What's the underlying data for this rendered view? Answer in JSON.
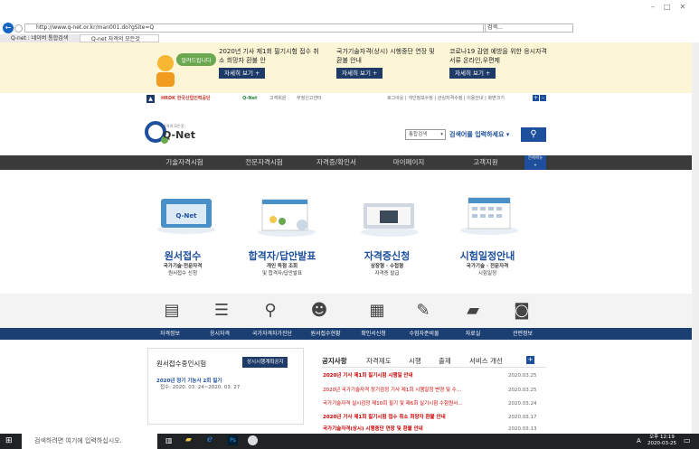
{
  "browser": {
    "address": "http://www.q-net.or.kr/man001.do?gSite=Q",
    "search_placeholder": "검색...",
    "tabs": [
      "Q-net : 네이버 통합검색",
      "Q-net 자격의 모든것"
    ]
  },
  "notice": {
    "items": [
      {
        "text": "2020년 기사 제1회 필기시험 접수 취소 희망자 환불 안",
        "button": "자세히 보기 +"
      },
      {
        "text": "국가기술자격(상시) 시행중단 연장 및 환불 안내",
        "button": "자세히 보기 +"
      },
      {
        "text": "코로나19 감염 예방을 위한 응시자격서류 온라인,우편제",
        "button": "자세히 보기 +"
      }
    ]
  },
  "util": {
    "left": [
      "HRDK 한국산업인력공단",
      "Q-Net",
      "고객회원",
      "부정신고센터"
    ],
    "right": "로그아웃 | 개인정보수정 | 관심자격수정 | 이용안내 | 화면크기"
  },
  "header": {
    "logo_small": "자격의 모든것",
    "logo": "Q-Net",
    "select": "통합검색",
    "search_placeholder": "검색어를 입력하세요"
  },
  "main_nav": [
    "기술자격시험",
    "전문자격시험",
    "자격증/확인서",
    "마이페이지",
    "고객지원",
    "전체메뉴"
  ],
  "quick": [
    {
      "title": "원서접수",
      "sub1": "국가기술·전문자격",
      "sub2": "원서접수 신청"
    },
    {
      "title": "합격자/답안발표",
      "sub1": "개인 득점 조회",
      "sub2": "및 합격자/답안발표"
    },
    {
      "title": "자격증신청",
      "sub1": "상장형 · 수첩형",
      "sub2": "자격증 발급"
    },
    {
      "title": "시험일정안내",
      "sub1": "국가기술 · 전문자격",
      "sub2": "시험일정"
    }
  ],
  "blue_nav": [
    "자격정보",
    "응시자격",
    "국가자격자가진단",
    "원서접수현황",
    "확인서신청",
    "수험자준비물",
    "자료실",
    "관련정보"
  ],
  "left_panel": {
    "title": "원서접수중인시험",
    "button": "상시시행계획공지",
    "item1": "2020년 정기 기능사 2회 필기",
    "item2": "접수: 2020. 03. 24~2020. 03. 27"
  },
  "right_panel": {
    "tabs": [
      "공지사항",
      "자격제도",
      "시행",
      "출제",
      "서비스 개선"
    ],
    "notices": [
      {
        "text": "2020년 기사 제1회 필기시험 시행일 안내",
        "date": "2020.03.25"
      },
      {
        "text": "2020년 국가기술자격 정기검정 기사 제1회 시행일정 변경 및 수...",
        "date": "2020.03.25"
      },
      {
        "text": "국가기술자격 실시검정 제10회 필기 및 제6회 실기시험 수험원서...",
        "date": "2020.03.24"
      },
      {
        "text": "2020년 기사 제1회 필기시험 접수 취소 희망자 환불 안내",
        "date": "2020.03.17"
      },
      {
        "text": "국가기술자격(상시) 시행중단 연장 및 환불 안내",
        "date": "2020.03.13"
      }
    ]
  },
  "taskbar": {
    "search": "검색하려면 여기에 입력하십시오.",
    "time": "오후 12:19",
    "date": "2020-03-25",
    "lang": "A"
  }
}
